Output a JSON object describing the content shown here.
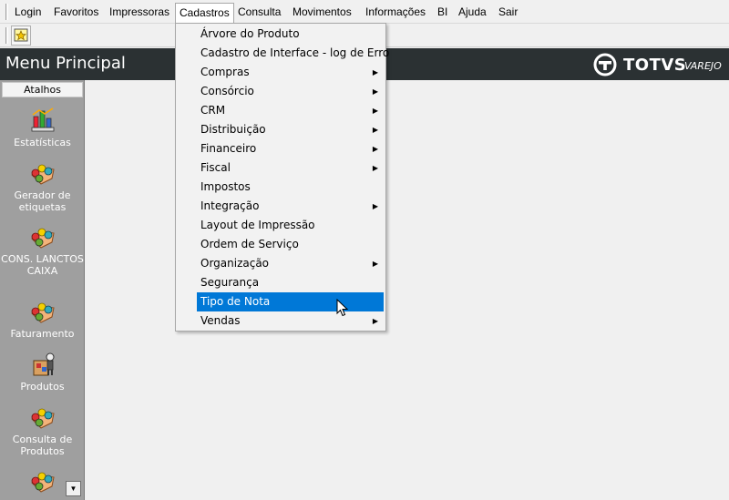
{
  "menubar": {
    "items": [
      {
        "label": "Login"
      },
      {
        "label": "Favoritos"
      },
      {
        "label": "Impressoras"
      },
      {
        "label": "Cadastros"
      },
      {
        "label": "Consulta"
      },
      {
        "label": "Movimentos"
      },
      {
        "label": "Informações"
      },
      {
        "label": "BI"
      },
      {
        "label": "Ajuda"
      },
      {
        "label": "Sair"
      }
    ]
  },
  "header": {
    "title": "Menu Principal",
    "logo_brand": "TOTVS",
    "logo_sub": "VAREJO"
  },
  "sidebar": {
    "tab": "Atalhos",
    "shortcuts": [
      {
        "label": "Estatísticas",
        "icon": "statistics-icon"
      },
      {
        "label": "Gerador de etiquetas",
        "icon": "puzzle-icon"
      },
      {
        "label": "CONS. LANCTOS CAIXA",
        "icon": "puzzle-icon"
      },
      {
        "label": "Faturamento",
        "icon": "puzzle-icon"
      },
      {
        "label": "Produtos",
        "icon": "products-icon"
      },
      {
        "label": "Consulta de Produtos",
        "icon": "puzzle-icon"
      }
    ]
  },
  "dropdown": {
    "items": [
      {
        "label": "Árvore do Produto",
        "submenu": false
      },
      {
        "label": "Cadastro de Interface - log de Erro",
        "submenu": false
      },
      {
        "label": "Compras",
        "submenu": true
      },
      {
        "label": "Consórcio",
        "submenu": true
      },
      {
        "label": "CRM",
        "submenu": true
      },
      {
        "label": "Distribuição",
        "submenu": true
      },
      {
        "label": "Financeiro",
        "submenu": true
      },
      {
        "label": "Fiscal",
        "submenu": true
      },
      {
        "label": "Impostos",
        "submenu": false
      },
      {
        "label": "Integração",
        "submenu": true
      },
      {
        "label": "Layout de Impressão",
        "submenu": false
      },
      {
        "label": "Ordem de Serviço",
        "submenu": false
      },
      {
        "label": "Organização",
        "submenu": true
      },
      {
        "label": "Segurança",
        "submenu": false
      },
      {
        "label": "Tipo de Nota",
        "submenu": false
      },
      {
        "label": "Vendas",
        "submenu": true
      }
    ]
  },
  "colors": {
    "header_bg": "#2b3133",
    "sidebar_bg": "#9f9f9f",
    "selection": "#0078d7"
  }
}
